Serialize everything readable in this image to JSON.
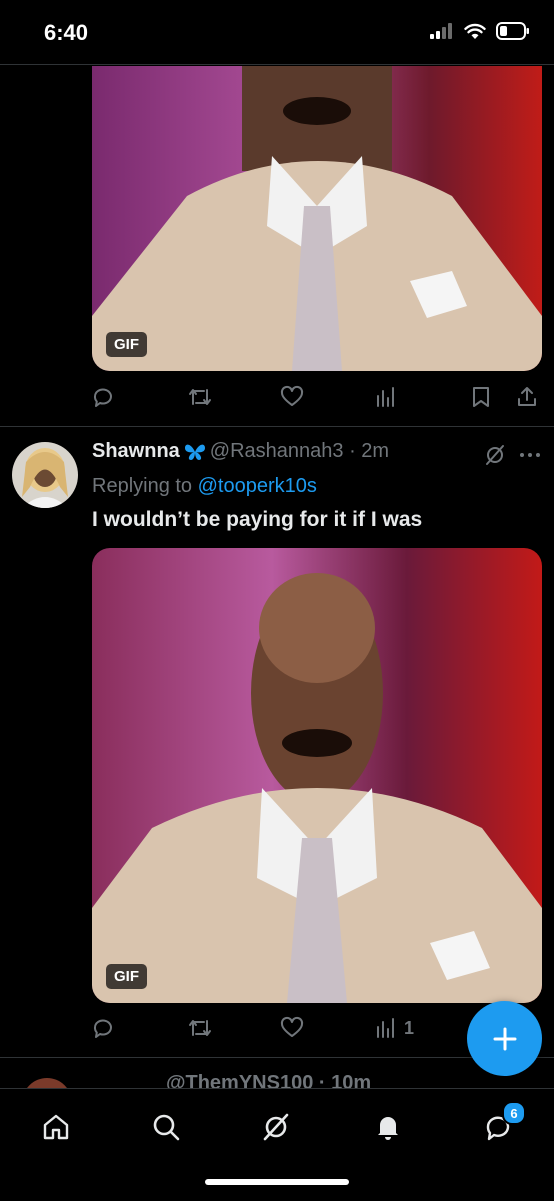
{
  "status_bar": {
    "time": "6:40"
  },
  "first_tweet": {
    "gif_badge": "GIF"
  },
  "tweet": {
    "display_name": "Shawnna",
    "handle_time": "@Rashannah3 · 2m",
    "replying_to_label": "Replying to",
    "replying_to_mention": "@tooperk10s",
    "text": "I wouldn’t be paying for it if I was",
    "gif_badge": "GIF",
    "views_count": "1"
  },
  "next_tweet": {
    "handle_time": "@ThemYNS100 · 10m"
  },
  "bottom_nav": {
    "notifications_badge": "6"
  },
  "colors": {
    "accent": "#1d9bf0",
    "muted": "#71767b",
    "background": "#000000"
  }
}
